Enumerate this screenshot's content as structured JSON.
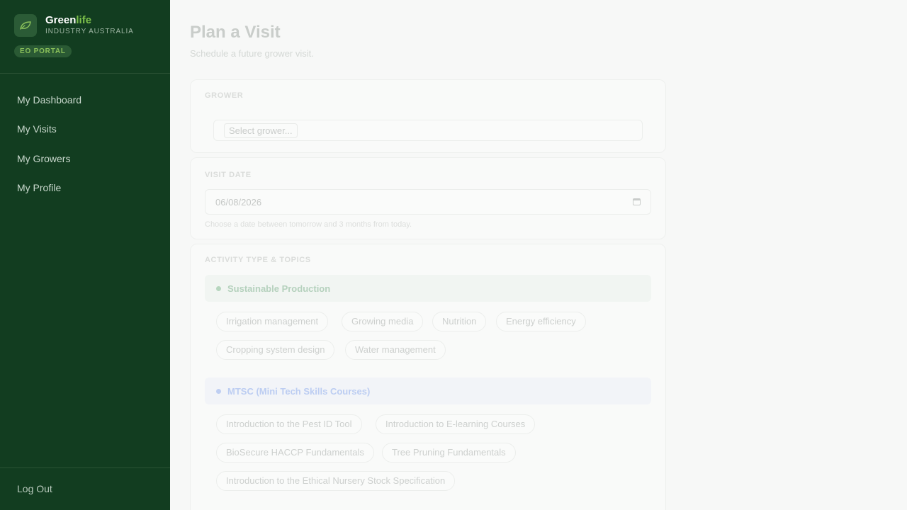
{
  "brand": {
    "name_main": "Green",
    "name_accent": "life",
    "subtitle": "INDUSTRY AUSTRALIA",
    "portal_badge": "EO PORTAL",
    "logo_icon": "leaf-icon",
    "accent_color": "#7cc04a",
    "sidebar_color": "#123d20"
  },
  "nav": {
    "items": [
      {
        "label": "My Dashboard"
      },
      {
        "label": "My Visits"
      },
      {
        "label": "My Growers"
      },
      {
        "label": "My Profile"
      }
    ],
    "logout_label": "Log Out"
  },
  "page": {
    "title": "Plan a Visit",
    "subtitle": "Schedule a future grower visit."
  },
  "grower": {
    "label": "GROWER",
    "placeholder": "Select grower..."
  },
  "visit_date": {
    "label": "VISIT DATE",
    "value": "06/08/2026",
    "hint": "Choose a date between tomorrow and 3 months from today."
  },
  "activity": {
    "label": "ACTIVITY TYPE & TOPICS",
    "groups": [
      {
        "name": "Sustainable Production",
        "topics": [
          "Irrigation management",
          "Growing media",
          "Nutrition",
          "Energy efficiency",
          "Cropping system design",
          "Water management"
        ]
      },
      {
        "name": "MTSC (Mini Tech Skills Courses)",
        "topics": [
          "Introduction to the Pest ID Tool",
          "Introduction to E-learning Courses",
          "BioSecure HACCP Fundamentals",
          "Tree Pruning Fundamentals",
          "Introduction to the Ethical Nursery Stock Specification"
        ]
      }
    ]
  }
}
